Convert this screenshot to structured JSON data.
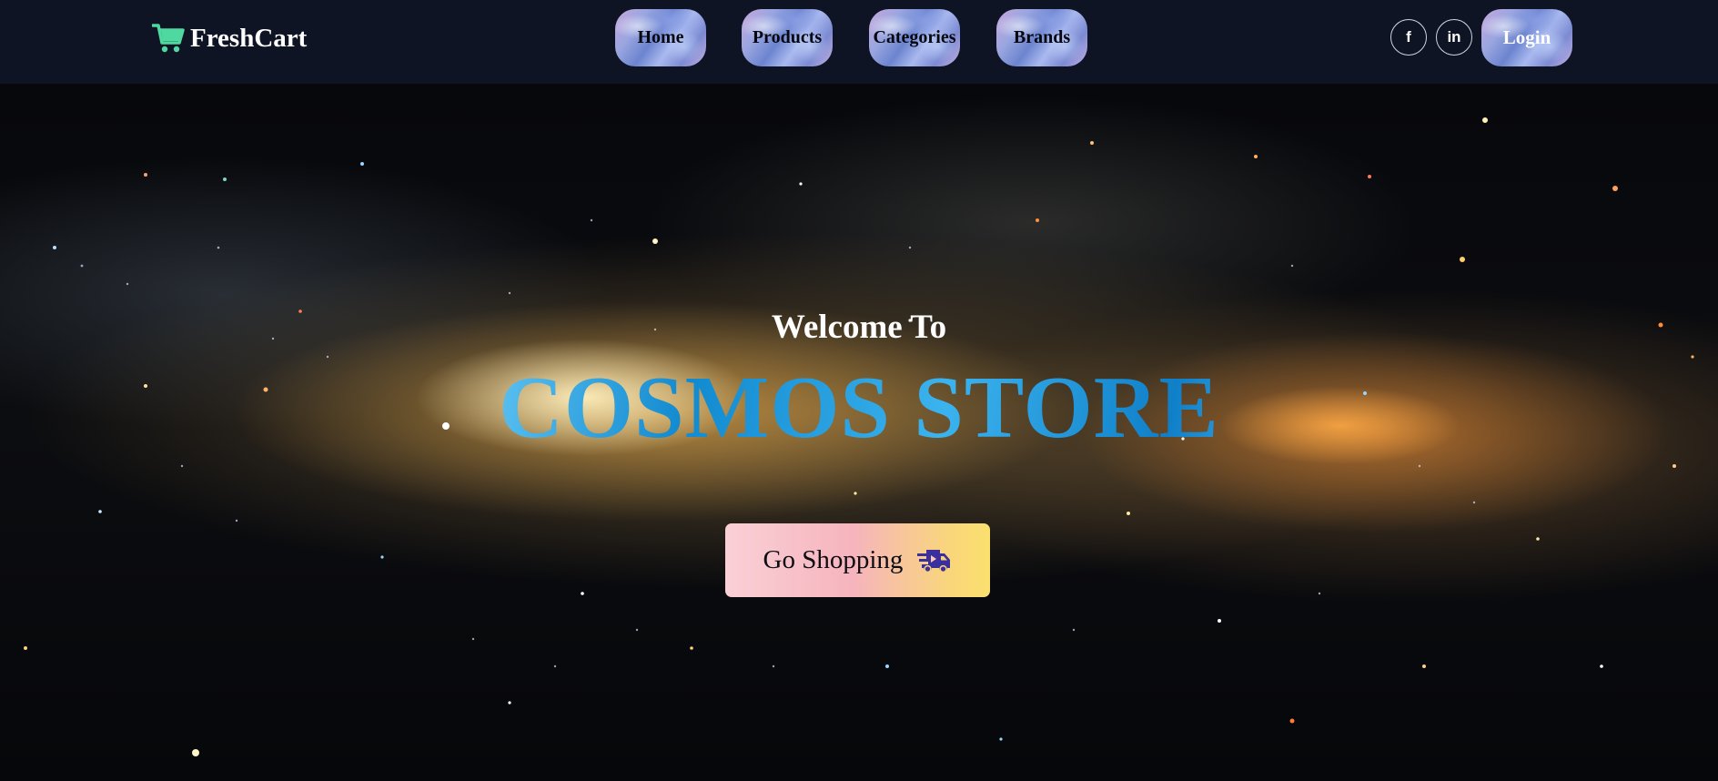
{
  "navbar": {
    "brand": {
      "name": "FreshCart",
      "icon": "shopping-cart-icon",
      "icon_color": "#4fd8a0"
    },
    "links": [
      {
        "label": "Home"
      },
      {
        "label": "Products"
      },
      {
        "label": "Categories"
      },
      {
        "label": "Brands"
      }
    ],
    "social": [
      {
        "icon": "facebook-icon",
        "glyph": "f"
      },
      {
        "icon": "linkedin-icon",
        "glyph": "in"
      }
    ],
    "login_label": "Login",
    "background_color": "#0e1424"
  },
  "hero": {
    "heading": "Welcome To",
    "title": "COSMOS STORE",
    "title_color": "#2aa3e6",
    "cta": {
      "label": "Go Shopping",
      "icon": "truck-fast-icon",
      "icon_color": "#3b2f9e"
    },
    "background": "galaxy-image"
  }
}
